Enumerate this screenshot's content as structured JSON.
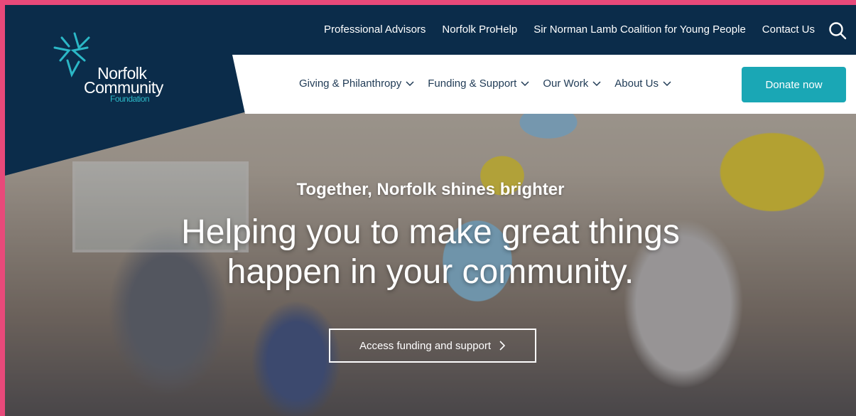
{
  "brand": {
    "name_line1": "Norfolk",
    "name_line2": "Community",
    "name_line3": "Foundation",
    "navy": "#0b2c4a",
    "teal": "#1aa7b5",
    "frame": "#e8497a"
  },
  "utility_nav": {
    "items": [
      "Professional Advisors",
      "Norfolk ProHelp",
      "Sir Norman Lamb Coalition for Young People",
      "Contact Us"
    ],
    "search_icon": "search-icon"
  },
  "main_nav": {
    "items": [
      "Giving & Philanthropy",
      "Funding & Support",
      "Our Work",
      "About Us"
    ],
    "donate_label": "Donate now"
  },
  "hero": {
    "tagline": "Together, Norfolk shines brighter",
    "headline_line1": "Helping you to make great things",
    "headline_line2": "happen in your community.",
    "cta_label": "Access funding and support"
  }
}
